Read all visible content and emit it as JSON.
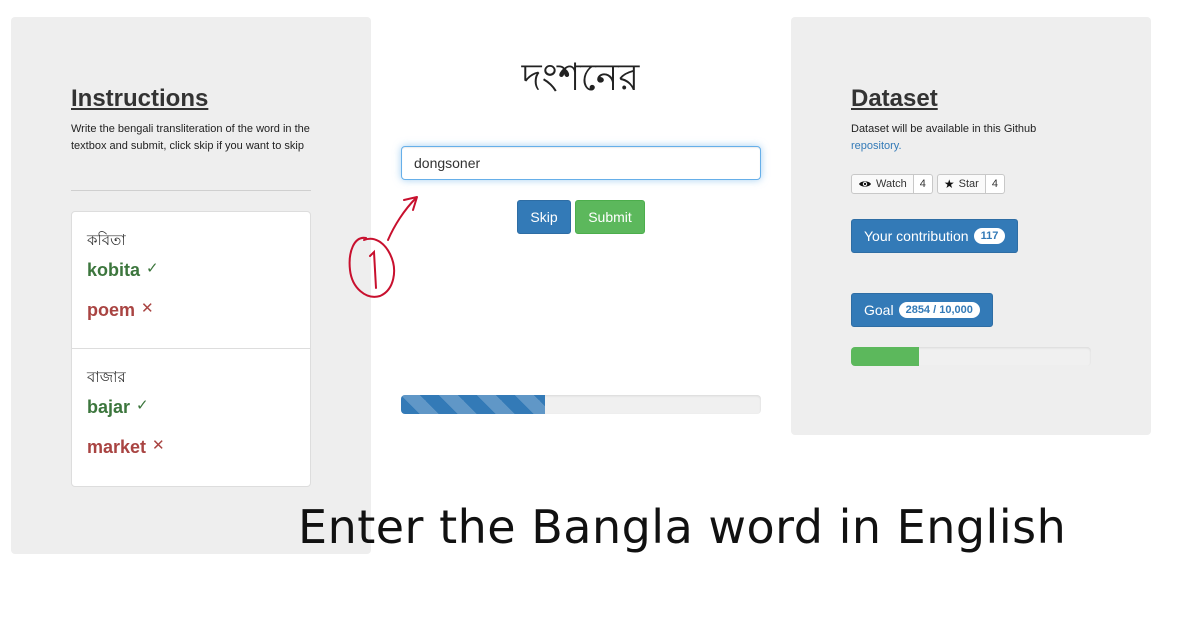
{
  "instructions": {
    "title": "Instructions",
    "text": "Write the bengali transliteration of the word in the textbox and submit, click skip if you want to skip",
    "examples": [
      {
        "bangla": "কবিতা",
        "transliteration": "kobita",
        "translation": "poem"
      },
      {
        "bangla": "বাজার",
        "transliteration": "bajar",
        "translation": "market"
      }
    ],
    "check_mark": "✓",
    "cross_mark": "✕"
  },
  "main": {
    "word": "দংশনের",
    "input_value": "dongsoner",
    "skip_label": "Skip",
    "submit_label": "Submit",
    "progress_fraction": 0.4
  },
  "dataset": {
    "title": "Dataset",
    "text_prefix": "Dataset will be available in this Github",
    "link_text": "repository.",
    "watch_label": "Watch",
    "watch_count": "4",
    "star_label": "Star",
    "star_count": "4",
    "contribution_label": "Your contribution",
    "contribution_count": "117",
    "goal_label": "Goal",
    "goal_value": "2854 / 10,000",
    "goal_fraction": 0.2854
  },
  "annotation": {
    "label": "1"
  },
  "caption": "Enter the Bangla word in English",
  "colors": {
    "primary": "#337ab7",
    "success": "#5cb85c",
    "correct_text": "#3c763d",
    "wrong_text": "#a94442",
    "annotation": "#c8102e"
  }
}
